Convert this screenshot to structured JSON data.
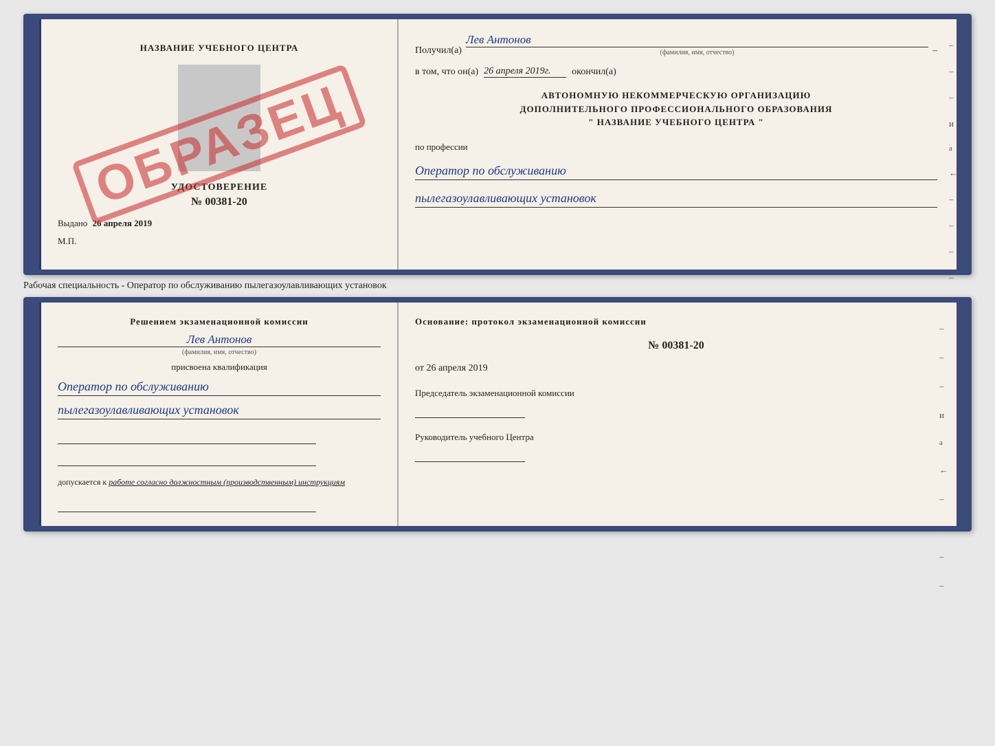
{
  "page": {
    "background": "#e8e8e8"
  },
  "top_cert": {
    "left": {
      "title": "НАЗВАНИЕ УЧЕБНОГО ЦЕНТРА",
      "stamp": "ОБРАЗЕЦ",
      "udostoverenie": "УДОСТОВЕРЕНИЕ",
      "number": "№ 00381-20",
      "vydano_label": "Выдано",
      "vydano_date": "26 апреля 2019",
      "mp": "М.П."
    },
    "right": {
      "poluchil_label": "Получил(а)",
      "poluchil_name": "Лев Антонов",
      "fio_hint": "(фамилия, имя, отчество)",
      "vtom_label": "в том, что он(а)",
      "vtom_date": "26 апреля 2019г.",
      "okonchil": "окончил(а)",
      "org_line1": "АВТОНОМНУЮ НЕКОММЕРЧЕСКУЮ ОРГАНИЗАЦИЮ",
      "org_line2": "ДОПОЛНИТЕЛЬНОГО ПРОФЕССИОНАЛЬНОГО ОБРАЗОВАНИЯ",
      "org_line3": "\"    НАЗВАНИЕ УЧЕБНОГО ЦЕНТРА    \"",
      "professiya_label": "по профессии",
      "professiya_line1": "Оператор по обслуживанию",
      "professiya_line2": "пылегазоулавливающих установок"
    }
  },
  "working_specialty": "Рабочая специальность - Оператор по обслуживанию пылегазоулавливающих установок",
  "bottom_cert": {
    "left": {
      "resheniem": "Решением экзаменационной комиссии",
      "name": "Лев Антонов",
      "fio_hint": "(фамилия, имя, отчество)",
      "prisvoena": "присвоена квалификация",
      "qual_line1": "Оператор по обслуживанию",
      "qual_line2": "пылегазоулавливающих установок",
      "dopuskaetsya_label": "допускается к",
      "dopuskaetsya_value": "работе согласно должностным (производственным) инструкциям"
    },
    "right": {
      "osnovaniye": "Основание: протокол экзаменационной комиссии",
      "protocol_number": "№ 00381-20",
      "protocol_date_prefix": "от",
      "protocol_date": "26 апреля 2019",
      "predsedatel_label": "Председатель экзаменационной комиссии",
      "rukovoditel_label": "Руководитель учебного Центра"
    }
  },
  "side_marks": {
    "right_chars": [
      "–",
      "–",
      "и",
      "а",
      "←",
      "–",
      "–",
      "–",
      "–"
    ]
  }
}
